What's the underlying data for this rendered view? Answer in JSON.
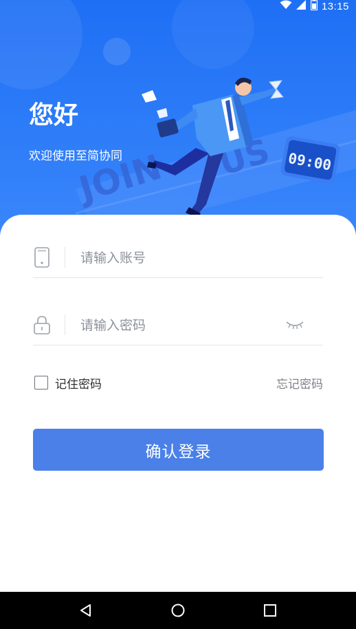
{
  "status_bar": {
    "time": "13:15",
    "icons": [
      "wifi-icon",
      "signal-icon",
      "battery-icon"
    ]
  },
  "hero": {
    "greeting": "您好",
    "welcome": "欢迎使用至简协同",
    "illustration": {
      "sign_text_left": "JOIN",
      "sign_text_right": "US",
      "clock_text": "09:00"
    }
  },
  "form": {
    "account": {
      "placeholder": "请输入账号",
      "icon": "phone-icon"
    },
    "password": {
      "placeholder": "请输入密码",
      "icon": "lock-icon",
      "toggle_icon": "eye-closed-icon"
    },
    "remember_label": "记住密码",
    "remember_checked": false,
    "forgot_label": "忘记密码",
    "login_label": "确认登录"
  },
  "navbar": {
    "buttons": [
      "back-icon",
      "home-icon",
      "recents-icon"
    ]
  },
  "colors": {
    "hero_blue": "#2d7cf8",
    "button_blue": "#4a80e8",
    "navbar": "#000000"
  }
}
